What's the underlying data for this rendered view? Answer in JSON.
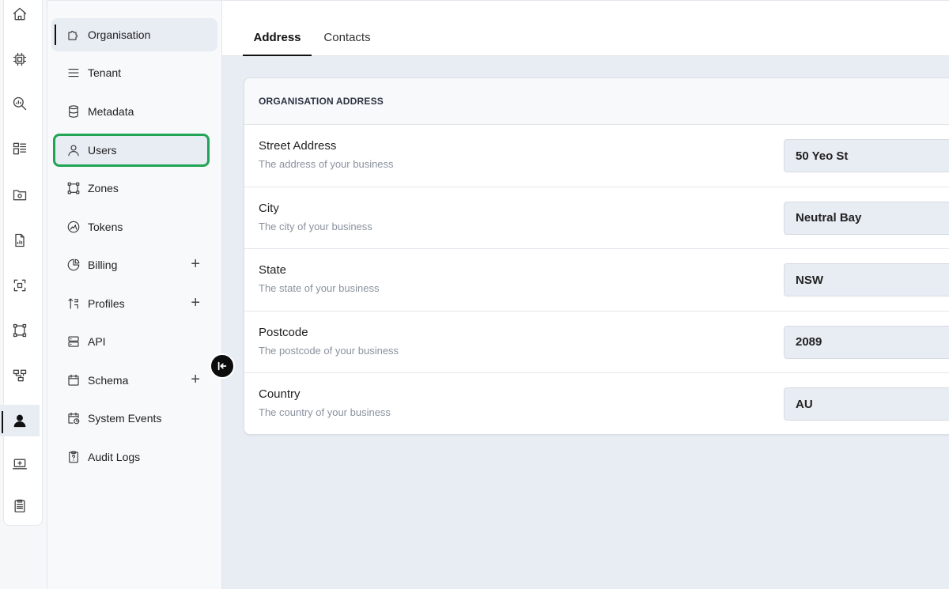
{
  "rail": {
    "icons": [
      "home-icon",
      "chip-icon",
      "search-chart-icon",
      "dashboard-icon",
      "folder-settings-icon",
      "file-chart-icon",
      "scan-icon",
      "frame-icon",
      "hierarchy-icon",
      "user-admin-icon",
      "laptop-plus-icon",
      "clipboard-list-icon"
    ]
  },
  "subnav": {
    "items": [
      {
        "label": "Organisation",
        "icon": "puzzle-icon"
      },
      {
        "label": "Tenant",
        "icon": "lines-icon"
      },
      {
        "label": "Metadata",
        "icon": "database-icon"
      },
      {
        "label": "Users",
        "icon": "user-icon"
      },
      {
        "label": "Zones",
        "icon": "frame-corners-icon"
      },
      {
        "label": "Tokens",
        "icon": "token-icon"
      },
      {
        "label": "Billing",
        "icon": "pie-chart-icon",
        "expand": "+"
      },
      {
        "label": "Profiles",
        "icon": "sort-icon",
        "expand": "+"
      },
      {
        "label": "API",
        "icon": "server-icon"
      },
      {
        "label": "Schema",
        "icon": "calendar-icon",
        "expand": "+"
      },
      {
        "label": "System Events",
        "icon": "calendar-clock-icon"
      },
      {
        "label": "Audit Logs",
        "icon": "clipboard-question-icon"
      }
    ]
  },
  "tabs": {
    "address": "Address",
    "contacts": "Contacts"
  },
  "card": {
    "title": "ORGANISATION ADDRESS",
    "rows": [
      {
        "label": "Street Address",
        "desc": "The address of your business",
        "value": "50 Yeo St"
      },
      {
        "label": "City",
        "desc": "The city of your business",
        "value": "Neutral Bay"
      },
      {
        "label": "State",
        "desc": "The state of your business",
        "value": "NSW"
      },
      {
        "label": "Postcode",
        "desc": "The postcode of your business",
        "value": "2089"
      },
      {
        "label": "Country",
        "desc": "The country of your business",
        "value": "AU"
      }
    ]
  },
  "colors": {
    "highlight": "#22a455",
    "active_bg": "#e8ecf3"
  }
}
